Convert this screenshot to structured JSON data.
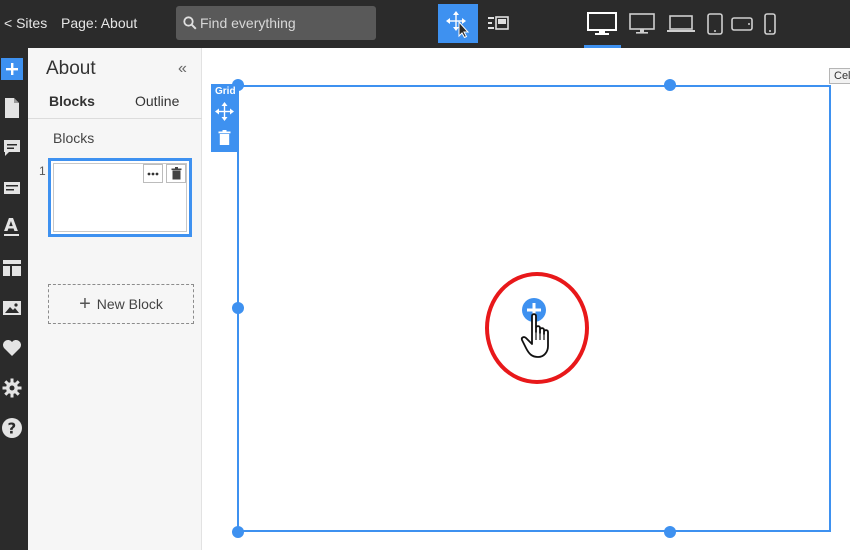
{
  "topbar": {
    "sites_link": "< Sites",
    "page_label": "Page: About",
    "search_placeholder": "Find everything",
    "tools": [
      "move-tool-icon",
      "layout-tool-icon"
    ],
    "devices": [
      "desktop-large-icon",
      "desktop-icon",
      "laptop-icon",
      "tablet-portrait-icon",
      "tablet-landscape-icon",
      "mobile-icon"
    ],
    "active_device": "desktop-large-icon"
  },
  "rail": {
    "items": [
      "add-icon",
      "page-icon",
      "comment-icon",
      "form-icon",
      "text-style-icon",
      "layout-icon",
      "image-icon",
      "heart-icon",
      "gear-icon",
      "help-icon"
    ]
  },
  "panel": {
    "title": "About",
    "collapse_glyph": "«",
    "tabs": [
      {
        "label": "Blocks",
        "active": true
      },
      {
        "label": "Outline",
        "active": false
      }
    ],
    "section_label": "Blocks",
    "block_number": "1",
    "new_block_label": "New Block",
    "new_block_glyph": "+"
  },
  "canvas": {
    "grid_label": "Grid",
    "cell_label": "Cel",
    "add_glyph": "+"
  },
  "colors": {
    "accent": "#3e91f0",
    "topbar_bg": "#2b2b2b",
    "highlight_ring": "#e8181a"
  }
}
